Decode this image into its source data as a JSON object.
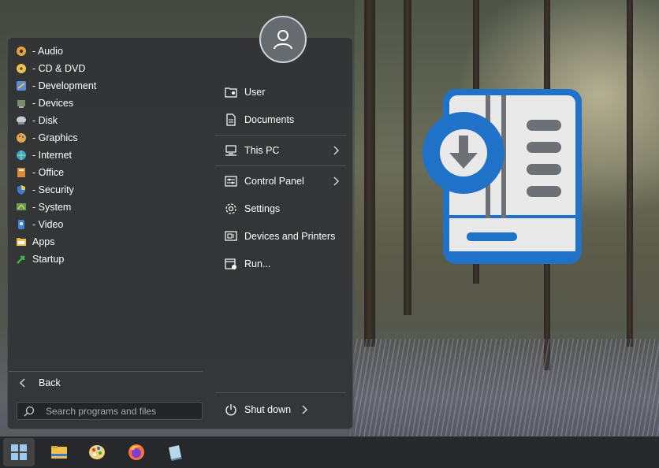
{
  "programs": [
    {
      "label": "- Audio",
      "icon": "audio-icon",
      "color": "#e6a23c"
    },
    {
      "label": "- CD & DVD",
      "icon": "disc-icon",
      "color": "#f0c24a"
    },
    {
      "label": "- Development",
      "icon": "development-icon",
      "color": "#5a8fd8"
    },
    {
      "label": "- Devices",
      "icon": "devices-icon",
      "color": "#7c8a6e"
    },
    {
      "label": "- Disk",
      "icon": "disk-icon",
      "color": "#c8ccd2"
    },
    {
      "label": "- Graphics",
      "icon": "graphics-icon",
      "color": "#e2a94a"
    },
    {
      "label": "- Internet",
      "icon": "internet-icon",
      "color": "#3aa0d8"
    },
    {
      "label": "- Office",
      "icon": "office-icon",
      "color": "#d98b3a"
    },
    {
      "label": "- Security",
      "icon": "security-icon",
      "color": "#3a7bd5"
    },
    {
      "label": "- System",
      "icon": "system-icon",
      "color": "#5aa05a"
    },
    {
      "label": "- Video",
      "icon": "video-icon",
      "color": "#4a7fd6"
    },
    {
      "label": "Apps",
      "icon": "apps-folder-icon",
      "color": "#f2c14a"
    },
    {
      "label": "Startup",
      "icon": "startup-icon",
      "color": "#3bb34a"
    }
  ],
  "right_menu": {
    "user": "User",
    "documents": "Documents",
    "this_pc": "This PC",
    "control_panel": "Control Panel",
    "settings": "Settings",
    "devices_printers": "Devices and Printers",
    "run": "Run..."
  },
  "back_label": "Back",
  "search": {
    "placeholder": "Search programs and files"
  },
  "shutdown_label": "Shut down",
  "taskbar": {
    "items": [
      "start-button-icon",
      "file-explorer-icon",
      "paint-icon",
      "firefox-icon",
      "app-icon"
    ]
  },
  "colors": {
    "accent_blue": "#1f72c7",
    "menu_bg": "#303234",
    "logo_light": "#e9e9ea",
    "logo_gray": "#6d7176"
  }
}
